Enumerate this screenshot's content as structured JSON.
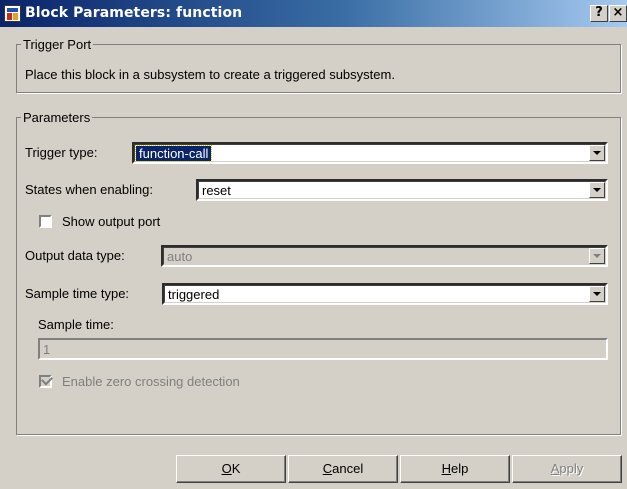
{
  "window": {
    "title": "Block Parameters: function",
    "help_glyph": "?",
    "close_glyph": "×"
  },
  "trigger_port": {
    "legend": "Trigger Port",
    "description": "Place this block in a subsystem to create a triggered subsystem."
  },
  "parameters": {
    "legend": "Parameters",
    "trigger_type": {
      "label": "Trigger type:",
      "value": "function-call"
    },
    "states_when_enabling": {
      "label": "States when enabling:",
      "value": "reset"
    },
    "show_output_port": {
      "label": "Show output port",
      "checked": false
    },
    "output_data_type": {
      "label": "Output data type:",
      "value": "auto",
      "disabled": true
    },
    "sample_time_type": {
      "label": "Sample time type:",
      "value": "triggered"
    },
    "sample_time": {
      "label": "Sample time:",
      "value": "1",
      "disabled": true
    },
    "enable_zero_crossing": {
      "label": "Enable zero crossing detection",
      "checked": true,
      "disabled": true
    }
  },
  "buttons": {
    "ok": {
      "mnemonic": "O",
      "rest": "K"
    },
    "cancel": {
      "mnemonic": "C",
      "rest": "ancel"
    },
    "help": {
      "mnemonic": "H",
      "rest": "elp"
    },
    "apply": {
      "mnemonic": "A",
      "rest": "pply",
      "disabled": true
    }
  },
  "colors": {
    "titlebar_start": "#0a246a",
    "titlebar_end": "#a6caf0",
    "dialog_bg": "#d4d0c8",
    "selection": "#0a246a"
  }
}
